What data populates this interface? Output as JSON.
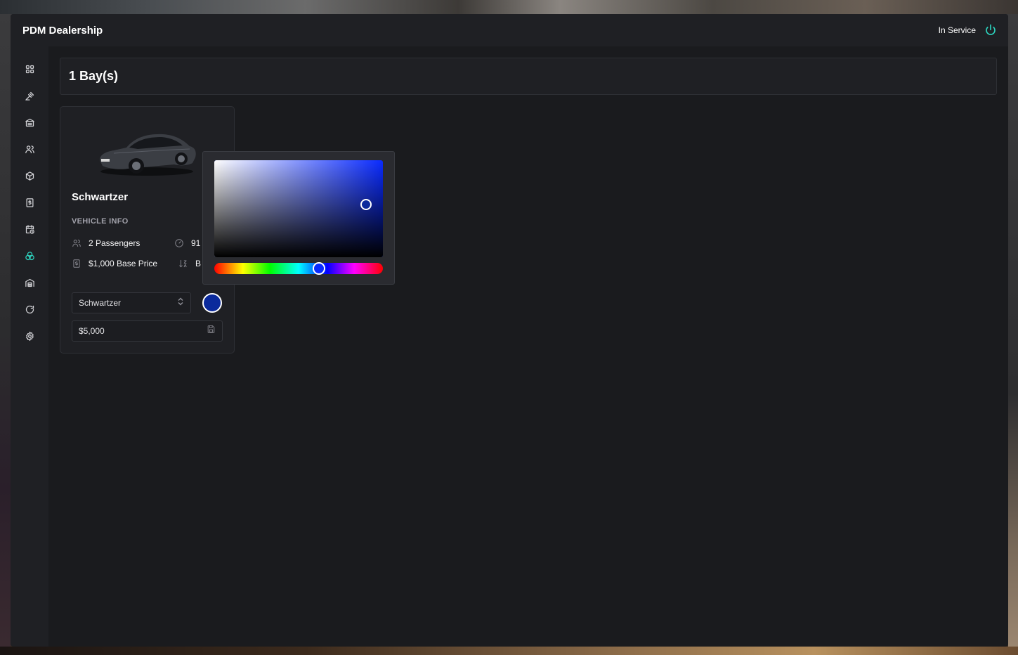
{
  "app": {
    "title": "PDM Dealership",
    "service_status": "In Service",
    "accent_color": "#2dd4bf"
  },
  "sidebar": {
    "items": [
      {
        "name": "dashboard",
        "icon": "grid-icon",
        "active": false
      },
      {
        "name": "auction",
        "icon": "gavel-icon",
        "active": false
      },
      {
        "name": "storage",
        "icon": "archive-icon",
        "active": false
      },
      {
        "name": "employees",
        "icon": "users-icon",
        "active": false
      },
      {
        "name": "stock",
        "icon": "box-icon",
        "active": false
      },
      {
        "name": "finance",
        "icon": "receipt-dollar-icon",
        "active": false
      },
      {
        "name": "calendar",
        "icon": "calendar-clock-icon",
        "active": false
      },
      {
        "name": "colors",
        "icon": "color-circles-icon",
        "active": true
      },
      {
        "name": "garage",
        "icon": "warehouse-icon",
        "active": false
      },
      {
        "name": "refresh",
        "icon": "refresh-icon",
        "active": false
      },
      {
        "name": "settings",
        "icon": "gear-icon",
        "active": false
      }
    ]
  },
  "main": {
    "bays_title": "1 Bay(s)",
    "card": {
      "vehicle_name": "Schwartzer",
      "section_label": "VEHICLE INFO",
      "passengers": "2 Passengers",
      "speed": "91",
      "base_price": "$1,000 Base Price",
      "class_partial": "B",
      "model_select_value": "Schwartzer",
      "sale_price": "$5,000",
      "selected_color": "#0b2a9c"
    }
  },
  "color_picker": {
    "hue_color": "#0a2bff",
    "hue_fraction": 0.62,
    "saturation_fraction": 0.9,
    "value_fraction": 0.54
  }
}
